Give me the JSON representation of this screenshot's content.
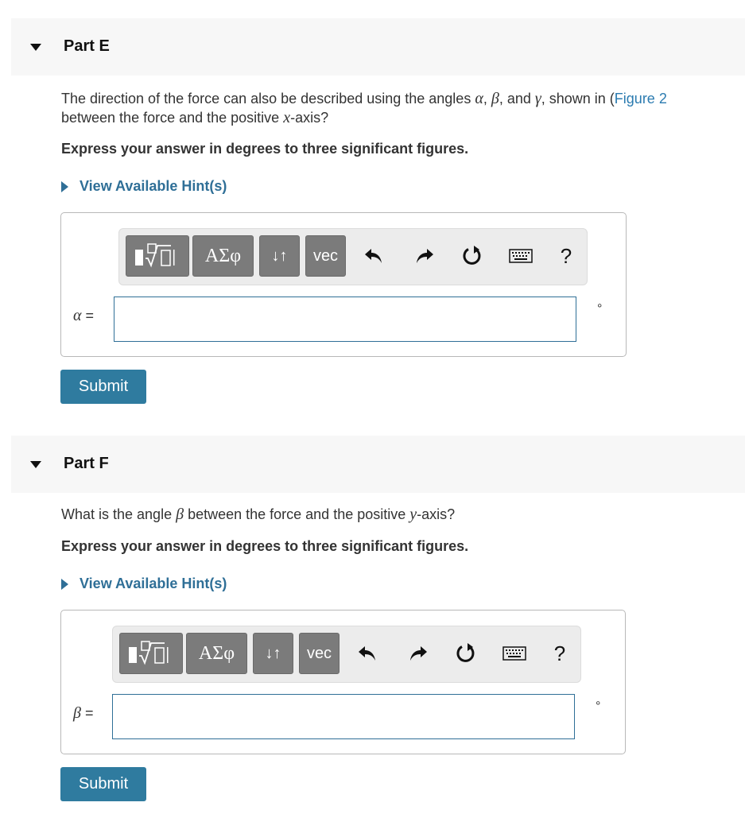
{
  "partE": {
    "title": "Part E",
    "question_line1_pre": "The direction of the force can also be described using the angles ",
    "sym_alpha": "α",
    "sym_beta": "β",
    "sym_gamma": "γ",
    "sep1": ", ",
    "sep2": ", and ",
    "question_line1_post": ", shown in (",
    "figure_link": "Figure 2",
    "question_line2_pre": "between the force and the positive ",
    "axis_var": "x",
    "question_line2_post": "-axis?",
    "instruction": "Express your answer in degrees to three significant figures.",
    "hint": "View Available Hint(s)",
    "variable": "α",
    "equals": " =",
    "input_value": "",
    "unit": "°",
    "submit": "Submit"
  },
  "partF": {
    "title": "Part F",
    "question_pre": "What is the angle ",
    "sym_beta": "β",
    "question_mid": " between the force and the positive ",
    "axis_var": "y",
    "question_post": "-axis?",
    "instruction": "Express your answer in degrees to three significant figures.",
    "hint": "View Available Hint(s)",
    "variable": "β",
    "equals": " =",
    "input_value": "",
    "unit": "°",
    "submit": "Submit"
  },
  "toolbar": {
    "templates_icon": "templates-icon",
    "greek_label": "ΑΣφ",
    "arrows_label": "↓↑",
    "vec_label": "vec",
    "undo_icon": "undo-icon",
    "redo_icon": "redo-icon",
    "reset_icon": "reset-icon",
    "keyboard_icon": "keyboard-icon",
    "help_label": "?"
  }
}
